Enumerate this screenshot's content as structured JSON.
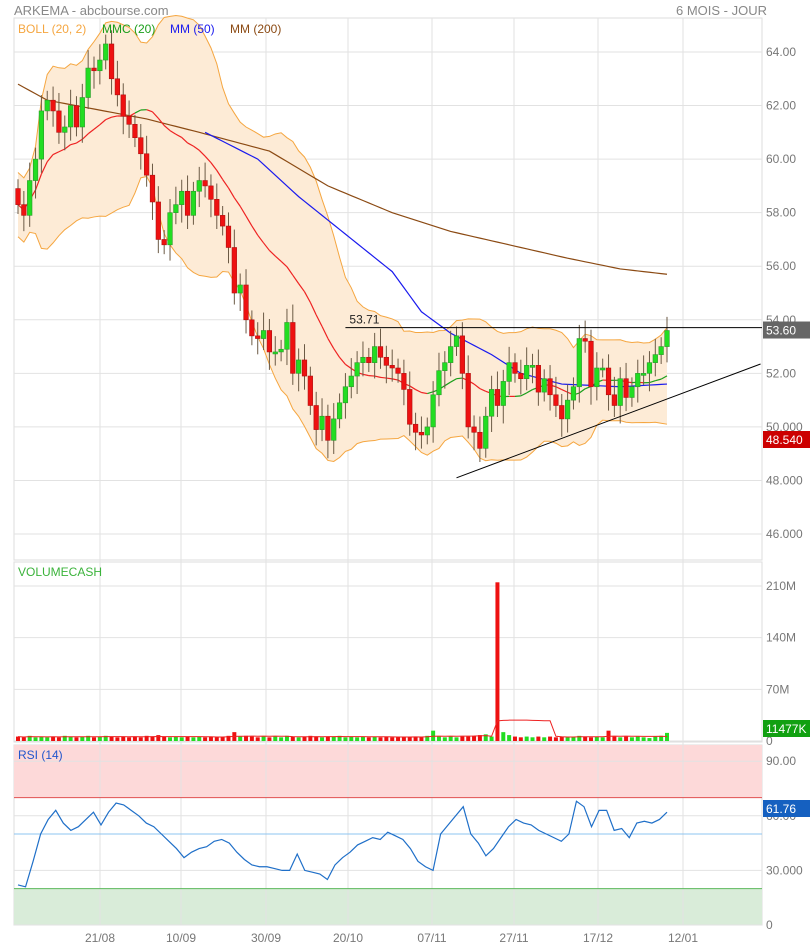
{
  "header": {
    "title": "ARKEMA - abcbourse.com",
    "period": "6 MOIS - JOUR"
  },
  "legend": [
    {
      "label": "BOLL (20, 2)",
      "color": "#f5a640"
    },
    {
      "label": "MMC (20)",
      "color": "#1a9e1a"
    },
    {
      "label": "MM (50)",
      "color": "#1a1aee"
    },
    {
      "label": "MM (200)",
      "color": "#8b4a13"
    }
  ],
  "x_labels": [
    "21/08",
    "10/09",
    "30/09",
    "20/10",
    "07/11",
    "27/11",
    "17/12",
    "12/01"
  ],
  "price_ticks": [
    "64.00",
    "62.00",
    "60.00",
    "58.00",
    "56.00",
    "54.00",
    "52.00",
    "50.000",
    "48.000",
    "46.000"
  ],
  "volume_title": "VOLUMECASH",
  "volume_ticks": [
    "210M",
    "140M",
    "70M",
    "0"
  ],
  "rsi_title": "RSI (14)",
  "rsi_ticks": [
    "90.00",
    "60.00",
    "30.000",
    "0"
  ],
  "badges": {
    "last_price": "53.60",
    "min_price": "48.540",
    "last_volume": "11477K",
    "last_rsi": "61.76"
  },
  "colors": {
    "up": "#22dd22",
    "down": "#ee1111",
    "boll_fill": "#fdebd6",
    "boll_line": "#f5a640",
    "mmc": "#ee2222",
    "mmc_up": "#1a9e1a",
    "mm50": "#1a1aee",
    "mm200": "#8b4a13",
    "rsi": "#1f6fc8"
  },
  "chart_data": {
    "type": "candlestick",
    "title": "ARKEMA",
    "ylim": [
      45,
      65
    ],
    "closes": [
      58.3,
      57.9,
      59.2,
      60.0,
      61.8,
      62.2,
      61.8,
      61.0,
      61.2,
      62.0,
      61.2,
      62.3,
      63.4,
      63.3,
      63.7,
      64.3,
      63.0,
      62.4,
      61.6,
      61.3,
      60.8,
      60.2,
      59.4,
      58.4,
      57.0,
      56.8,
      58.0,
      58.3,
      58.8,
      57.9,
      58.8,
      59.2,
      59.0,
      58.5,
      57.9,
      57.5,
      56.7,
      55.0,
      55.3,
      54.0,
      53.4,
      53.3,
      53.6,
      52.8,
      52.8,
      52.9,
      53.9,
      52.0,
      52.5,
      51.9,
      50.8,
      49.9,
      50.4,
      49.5,
      50.3,
      50.9,
      51.5,
      51.9,
      52.4,
      52.6,
      52.4,
      53.0,
      52.6,
      52.3,
      52.2,
      52.0,
      51.4,
      50.1,
      49.8,
      49.7,
      50.0,
      51.2,
      52.1,
      52.4,
      53.0,
      53.4,
      52.0,
      50.0,
      49.8,
      49.2,
      50.4,
      51.4,
      50.8,
      51.7,
      52.4,
      52.0,
      51.8,
      52.3,
      52.3,
      51.3,
      51.8,
      51.2,
      50.8,
      50.3,
      51.0,
      51.5,
      53.3,
      53.2,
      51.5,
      52.2,
      52.2,
      51.2,
      50.8,
      51.8,
      51.1,
      51.5,
      52.0,
      52.0,
      52.4,
      52.7,
      53.0,
      53.6
    ],
    "first_open": 58.9,
    "mm50": [
      [
        32,
        61.0
      ],
      [
        41,
        60.0
      ],
      [
        48,
        58.6
      ],
      [
        56,
        57.2
      ],
      [
        64,
        55.8
      ],
      [
        69,
        54.3
      ],
      [
        74,
        53.5
      ],
      [
        81,
        52.7
      ],
      [
        86,
        52.0
      ],
      [
        93,
        51.6
      ],
      [
        103,
        51.5
      ],
      [
        111,
        51.6
      ]
    ],
    "mm200": [
      [
        0,
        62.8
      ],
      [
        5,
        62.2
      ],
      [
        22,
        61.5
      ],
      [
        31,
        61.0
      ],
      [
        43,
        60.3
      ],
      [
        53,
        59.0
      ],
      [
        64,
        58.0
      ],
      [
        74,
        57.3
      ],
      [
        82,
        56.9
      ],
      [
        94,
        56.3
      ],
      [
        103,
        55.9
      ],
      [
        111,
        55.7
      ]
    ],
    "resistance": {
      "label": "53.71",
      "price": 53.71,
      "from_index": 56
    },
    "support": {
      "from_index": 75,
      "from_price": 48.1,
      "to_index": 127,
      "to_price": 52.35
    },
    "volumes_m": [
      6,
      5,
      7,
      5,
      6,
      5,
      6,
      5,
      7,
      6,
      5,
      6,
      7,
      5,
      6,
      7,
      6,
      5,
      6,
      5,
      6,
      5,
      7,
      6,
      8,
      6,
      5,
      6,
      5,
      6,
      5,
      6,
      5,
      6,
      5,
      6,
      7,
      12,
      6,
      7,
      6,
      5,
      6,
      5,
      6,
      5,
      7,
      6,
      5,
      6,
      7,
      6,
      5,
      6,
      6,
      7,
      5,
      6,
      5,
      6,
      5,
      6,
      5,
      6,
      5,
      6,
      5,
      6,
      6,
      5,
      7,
      14,
      6,
      5,
      6,
      5,
      6,
      6,
      7,
      8,
      9,
      6,
      215,
      12,
      8,
      6,
      5,
      6,
      5,
      6,
      5,
      6,
      5,
      6,
      5,
      6,
      7,
      6,
      5,
      6,
      5,
      14,
      6,
      5,
      6,
      5,
      6,
      5,
      4,
      6,
      7,
      11
    ],
    "volume_ylim": [
      0,
      210
    ],
    "rsi": [
      22,
      21,
      35,
      50,
      58,
      63,
      56,
      52,
      54,
      58,
      62,
      55,
      62,
      67,
      66,
      63,
      60,
      56,
      54,
      50,
      46,
      42,
      37,
      40,
      42,
      43,
      46,
      47,
      45,
      40,
      36,
      33,
      32,
      32,
      31,
      30,
      30,
      39,
      30,
      29,
      28,
      25,
      33,
      37,
      40,
      44,
      46,
      48,
      47,
      51,
      49,
      47,
      42,
      35,
      32,
      30,
      50,
      55,
      60,
      65,
      50,
      45,
      38,
      42,
      48,
      54,
      58,
      56,
      55,
      52,
      50,
      48,
      46,
      50,
      68,
      65,
      54,
      63,
      63,
      52,
      53,
      48,
      56,
      57,
      56,
      58,
      62
    ],
    "rsi_levels": {
      "overbought": 70,
      "middle": 50,
      "oversold": 20
    },
    "rsi_ylim": [
      0,
      100
    ]
  }
}
